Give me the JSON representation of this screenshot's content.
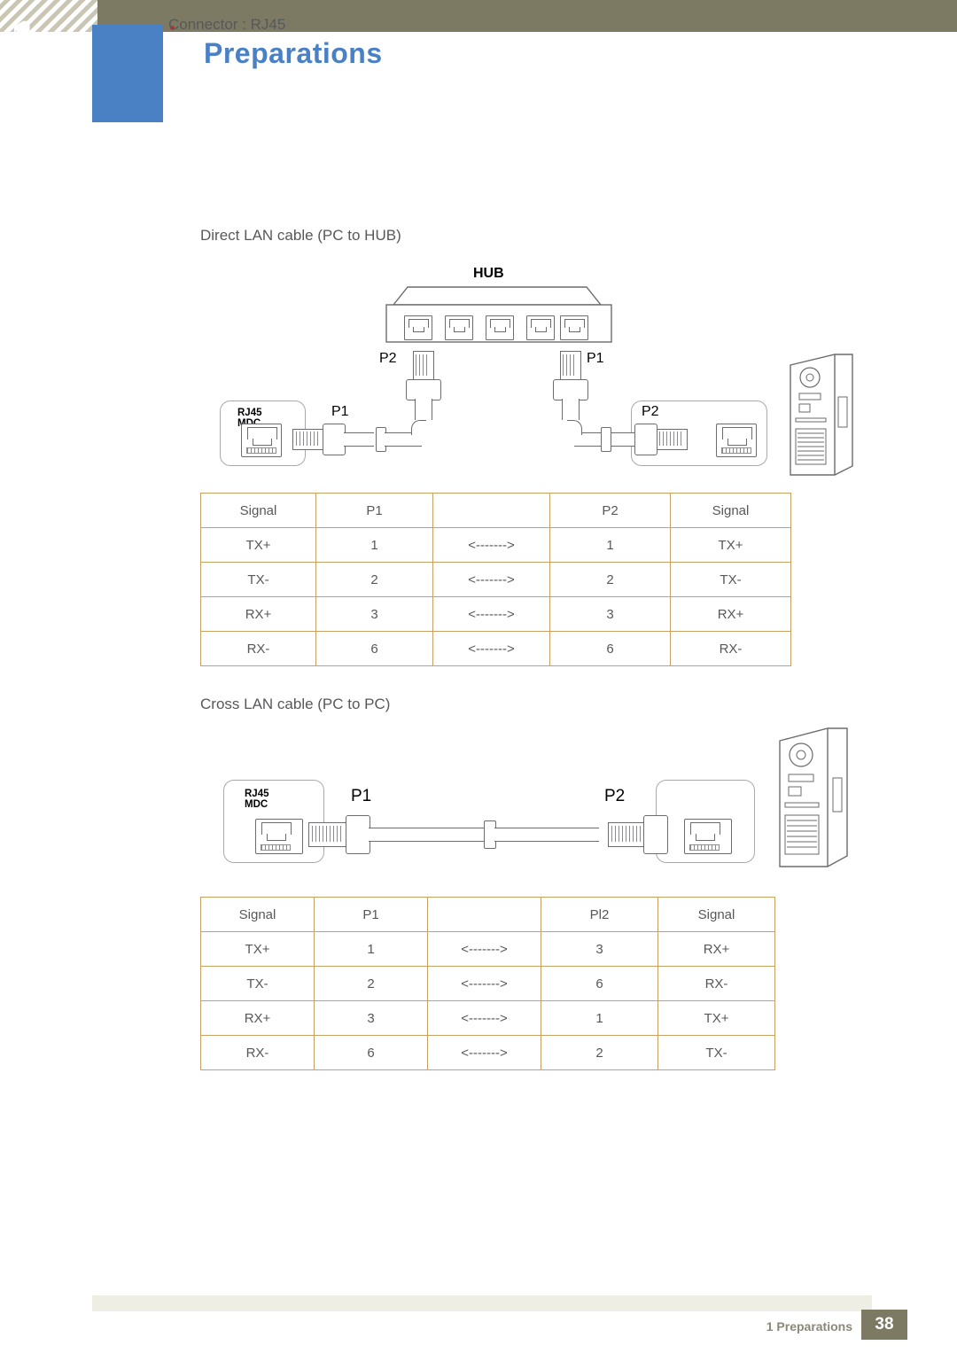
{
  "header": {
    "chapter_number": "1",
    "chapter_title": "Preparations"
  },
  "content": {
    "connector_line": "Connector : RJ45",
    "direct_label": "Direct LAN cable (PC to HUB)",
    "cross_label": "Cross LAN cable (PC to PC)"
  },
  "diagram_direct": {
    "hub_label": "HUB",
    "hub_port_p2": "P2",
    "hub_port_p1": "P1",
    "mdc_label": "RJ45 MDC",
    "left_plug_label": "P1",
    "right_plug_label": "P2"
  },
  "diagram_cross": {
    "mdc_label": "RJ45 MDC",
    "left_plug_label": "P1",
    "right_plug_label": "P2"
  },
  "table_direct": {
    "headers": [
      "Signal",
      "P1",
      "",
      "P2",
      "Signal"
    ],
    "rows": [
      [
        "TX+",
        "1",
        "<------->",
        "1",
        "TX+"
      ],
      [
        "TX-",
        "2",
        "<------->",
        "2",
        "TX-"
      ],
      [
        "RX+",
        "3",
        "<------->",
        "3",
        "RX+"
      ],
      [
        "RX-",
        "6",
        "<------->",
        "6",
        "RX-"
      ]
    ]
  },
  "table_cross": {
    "headers": [
      "Signal",
      "P1",
      "",
      "Pl2",
      "Signal"
    ],
    "rows": [
      [
        "TX+",
        "1",
        "<------->",
        "3",
        "RX+"
      ],
      [
        "TX-",
        "2",
        "<------->",
        "6",
        "RX-"
      ],
      [
        "RX+",
        "3",
        "<------->",
        "1",
        "TX+"
      ],
      [
        "RX-",
        "6",
        "<------->",
        "2",
        "TX-"
      ]
    ]
  },
  "footer": {
    "text": "1 Preparations",
    "page": "38"
  },
  "colors": {
    "header_bar": "#7c7a63",
    "chapter_tab": "#4a80c4",
    "title": "#4a80c4",
    "table_border": "#c8a063",
    "body_text": "#58585a"
  }
}
